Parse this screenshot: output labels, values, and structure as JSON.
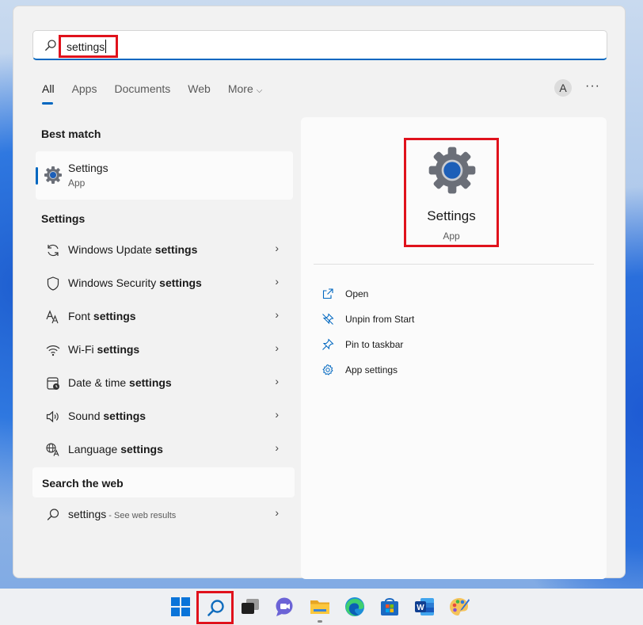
{
  "search": {
    "query": "settings"
  },
  "tabs": [
    {
      "label": "All",
      "active": true
    },
    {
      "label": "Apps"
    },
    {
      "label": "Documents"
    },
    {
      "label": "Web"
    },
    {
      "label": "More"
    }
  ],
  "header": {
    "avatar_initial": "A",
    "more_options": "···"
  },
  "best_match": {
    "heading": "Best match",
    "title": "Settings",
    "subtitle": "App"
  },
  "settings_section": {
    "heading": "Settings",
    "items": [
      {
        "prefix": "Windows Update ",
        "bold": "settings",
        "icon": "refresh-icon"
      },
      {
        "prefix": "Windows Security ",
        "bold": "settings",
        "icon": "shield-icon"
      },
      {
        "prefix": "Font ",
        "bold": "settings",
        "icon": "font-icon"
      },
      {
        "prefix": "Wi-Fi ",
        "bold": "settings",
        "icon": "wifi-icon"
      },
      {
        "prefix": "Date & time ",
        "bold": "settings",
        "icon": "calendar-clock-icon"
      },
      {
        "prefix": "Sound ",
        "bold": "settings",
        "icon": "speaker-icon"
      },
      {
        "prefix": "Language ",
        "bold": "settings",
        "icon": "language-icon"
      }
    ]
  },
  "web_section": {
    "heading": "Search the web",
    "query": "settings",
    "suffix": " - See web results"
  },
  "preview": {
    "name": "Settings",
    "type": "App",
    "actions": [
      {
        "label": "Open",
        "icon": "open-external-icon"
      },
      {
        "label": "Unpin from Start",
        "icon": "unpin-icon"
      },
      {
        "label": "Pin to taskbar",
        "icon": "pin-icon"
      },
      {
        "label": "App settings",
        "icon": "gear-icon"
      }
    ]
  },
  "colors": {
    "accent": "#0067c0",
    "highlight": "#e0121c"
  }
}
